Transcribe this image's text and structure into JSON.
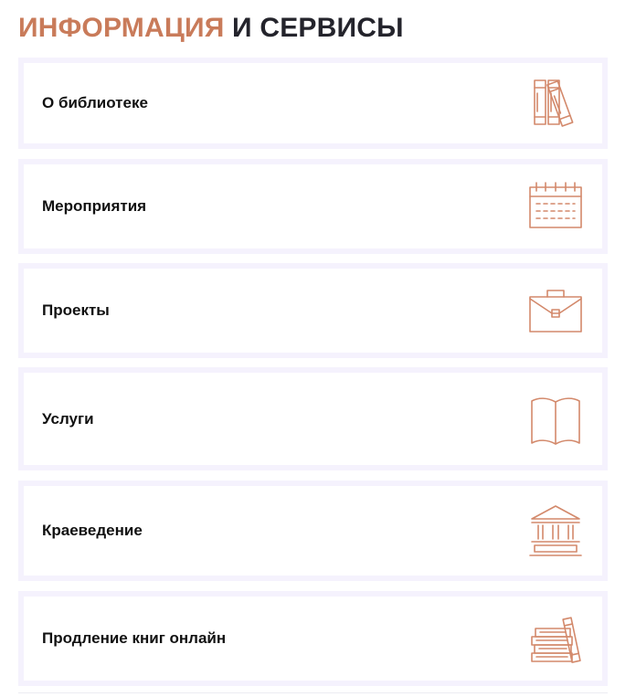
{
  "header": {
    "title_accent": "ИНФОРМАЦИЯ",
    "title_rest": "И СЕРВИСЫ"
  },
  "colors": {
    "accent": "#c97b5a",
    "icon": "#d3896b",
    "heading": "#24242c",
    "card_border": "#f5f2fd"
  },
  "menu": {
    "items": [
      {
        "label": "О библиотеке",
        "icon": "books-icon"
      },
      {
        "label": "Мероприятия",
        "icon": "calendar-icon"
      },
      {
        "label": "Проекты",
        "icon": "briefcase-icon"
      },
      {
        "label": "Услуги",
        "icon": "open-book-icon"
      },
      {
        "label": "Краеведение",
        "icon": "museum-icon"
      },
      {
        "label": "Продление книг онлайн",
        "icon": "book-stack-icon"
      }
    ]
  }
}
